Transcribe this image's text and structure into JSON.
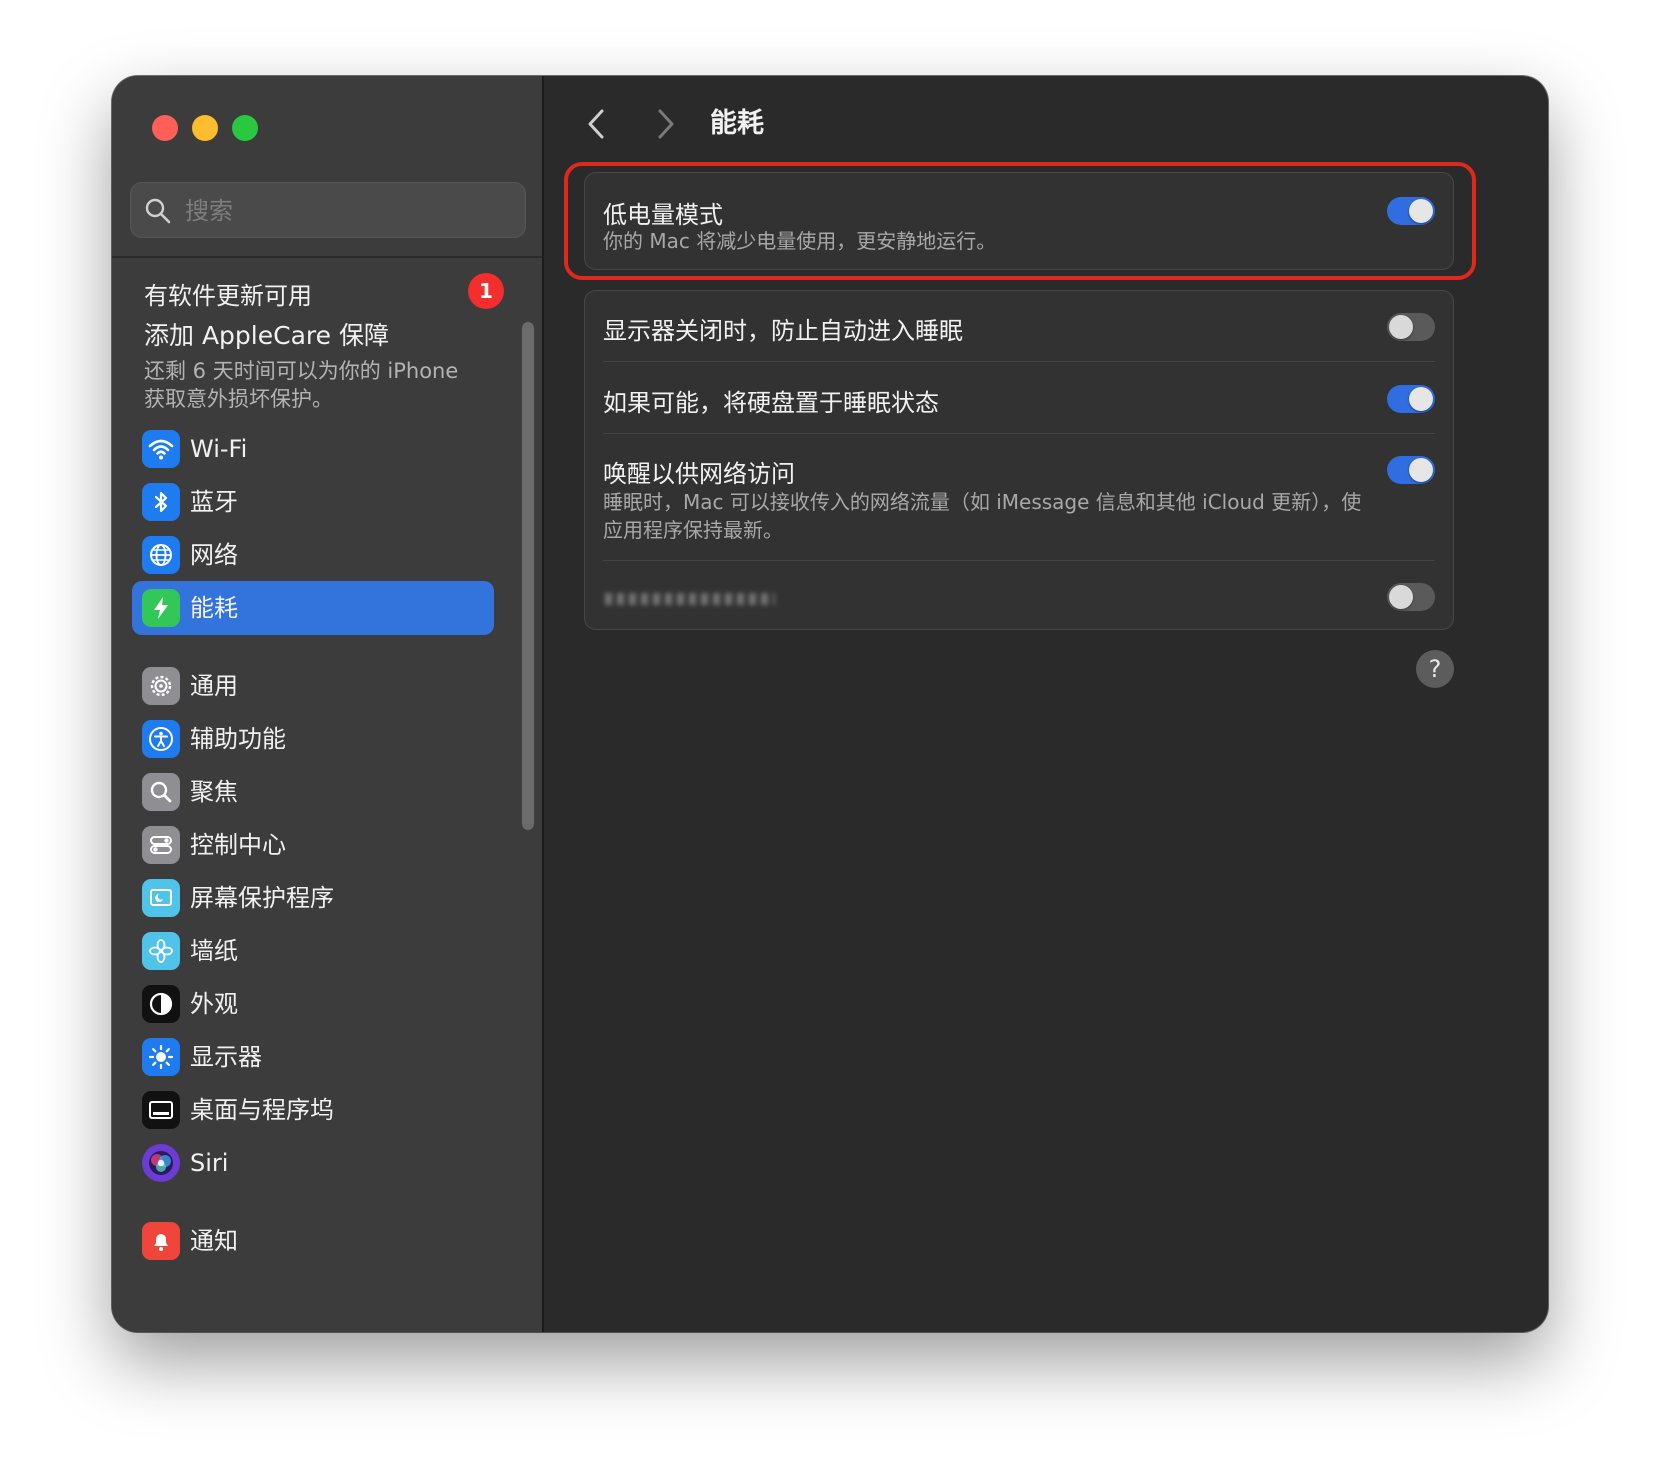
{
  "sidebar": {
    "search": {
      "placeholder": "搜索"
    },
    "update": {
      "label": "有软件更新可用",
      "badge": "1"
    },
    "applecare": {
      "title": "添加 AppleCare 保障",
      "desc_line1": "还剩 6 天时间可以为你的 iPhone",
      "desc_line2": "获取意外损坏保护。"
    },
    "items": [
      {
        "id": "wifi",
        "label": "Wi-Fi",
        "icon": "wifi-icon",
        "color": "#1e7cf0"
      },
      {
        "id": "bluetooth",
        "label": "蓝牙",
        "icon": "bluetooth-icon",
        "color": "#1e7cf0"
      },
      {
        "id": "network",
        "label": "网络",
        "icon": "globe-icon",
        "color": "#1e7cf0"
      },
      {
        "id": "battery",
        "label": "能耗",
        "icon": "bolt-icon",
        "color": "#33c759"
      },
      {
        "id": "general",
        "label": "通用",
        "icon": "gear-icon",
        "color": "#8e8e93"
      },
      {
        "id": "accessibility",
        "label": "辅助功能",
        "icon": "accessibility-icon",
        "color": "#1e7cf0"
      },
      {
        "id": "spotlight",
        "label": "聚焦",
        "icon": "magnifier-icon",
        "color": "#8e8e93"
      },
      {
        "id": "control-center",
        "label": "控制中心",
        "icon": "toggles-icon",
        "color": "#8e8e93"
      },
      {
        "id": "screensaver",
        "label": "屏幕保护程序",
        "icon": "screensaver-icon",
        "color": "#4fc3e8"
      },
      {
        "id": "wallpaper",
        "label": "墙纸",
        "icon": "flower-icon",
        "color": "#4fc3e8"
      },
      {
        "id": "appearance",
        "label": "外观",
        "icon": "appearance-icon",
        "color": "#111111"
      },
      {
        "id": "displays",
        "label": "显示器",
        "icon": "sun-icon",
        "color": "#1e7cf0"
      },
      {
        "id": "dock",
        "label": "桌面与程序坞",
        "icon": "dock-icon",
        "color": "#111111"
      },
      {
        "id": "siri",
        "label": "Siri",
        "icon": "siri-icon",
        "color": "#6d3bd6"
      },
      {
        "id": "notifications",
        "label": "通知",
        "icon": "bell-icon",
        "color": "#f0453a"
      }
    ],
    "selected_color": "#3273dc"
  },
  "header": {
    "title": "能耗",
    "back": "chevron-left-icon",
    "forward": "chevron-right-icon"
  },
  "settings": {
    "low_power": {
      "title": "低电量模式",
      "desc": "你的 Mac 将减少电量使用，更安静地运行。",
      "on": true
    },
    "prevent_sleep": {
      "title": "显示器关闭时，防止自动进入睡眠",
      "on": false
    },
    "disk_sleep": {
      "title": "如果可能，将硬盘置于睡眠状态",
      "on": true
    },
    "wake_network": {
      "title": "唤醒以供网络访问",
      "desc_line1": "睡眠时，Mac 可以接收传入的网络流量（如 iMessage 信息和其他 iCloud 更新），使",
      "desc_line2": "应用程序保持最新。",
      "on": true
    },
    "hidden_row": {
      "on": false
    }
  },
  "help": {
    "label": "?"
  },
  "colors": {
    "accent": "#2f6de0",
    "highlight": "#e0281b",
    "badge": "#f42d2d"
  }
}
